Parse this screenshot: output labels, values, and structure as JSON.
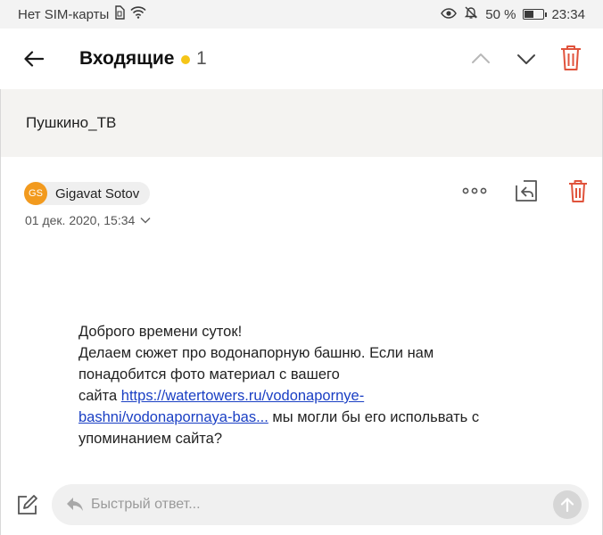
{
  "status_bar": {
    "carrier": "Нет SIM-карты",
    "battery_percent": "50 %",
    "battery_level": 0.5,
    "time": "23:34",
    "icons": [
      "sim-icon",
      "wifi-icon",
      "eye-icon",
      "mute-icon",
      "battery-icon"
    ]
  },
  "header": {
    "title": "Входящие",
    "unread_count": "1",
    "dot_color": "#f5c518",
    "icons": [
      "back-arrow-icon",
      "chevron-up-icon",
      "chevron-down-icon",
      "trash-icon"
    ]
  },
  "message": {
    "subject": "Пушкино_ТВ",
    "sender": {
      "initials": "GS",
      "name": "Gigavat Sotov",
      "avatar_color": "#f29a1e"
    },
    "date": "01 дек. 2020, 15:34",
    "actions_icons": [
      "more-icon",
      "reply-all-icon",
      "trash-icon"
    ],
    "body": {
      "line1": "Доброго времени суток!",
      "line2": "Делаем сюжет про водонапорную башню. Если нам",
      "line3": "понадобится фото материал с вашего",
      "line4_prefix": "сайта",
      "link_part1": "https://watertowers.ru/vodonapornye-",
      "link_part2": "bashni/vodonapornaya-bas...",
      "line5_suffix": " мы могли бы его испольвать с",
      "line6": "упоминанием сайта?"
    }
  },
  "quick_reply": {
    "placeholder": "Быстрый ответ..."
  },
  "colors": {
    "accent_delete": "#e0533c",
    "link": "#1a3fc4",
    "subject_bg": "#f4f3f1"
  }
}
